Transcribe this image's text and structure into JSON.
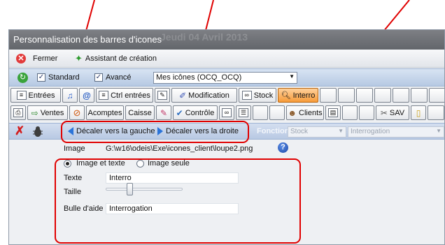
{
  "window": {
    "title": "Personnalisation des barres d'icones",
    "ghost_title": "Jeudi 04 Avril 2013"
  },
  "toolbar": {
    "close_label": "Fermer",
    "wizard_label": "Assistant de création"
  },
  "options": {
    "standard": {
      "label": "Standard",
      "checked": true
    },
    "avance": {
      "label": "Avancé",
      "checked": true
    },
    "icon_set": "Mes icônes (OCQ_OCQ)"
  },
  "icon_row_1": [
    {
      "label": "Entrées",
      "icon": "list-icon"
    },
    {
      "label": "",
      "icon": "music-icon"
    },
    {
      "label": "",
      "icon": "at-icon"
    },
    {
      "label": "Ctrl entrées",
      "icon": "list-icon"
    },
    {
      "label": "",
      "icon": "pen-icon"
    },
    {
      "label": "Modification",
      "icon": "edit-icon"
    },
    {
      "label": "Stock",
      "icon": "binoculars-icon"
    },
    {
      "label": "Interro",
      "icon": "magnifier-icon",
      "active": true
    }
  ],
  "icon_row_2": [
    {
      "label": "",
      "icon": "printer-icon"
    },
    {
      "label": "Ventes",
      "icon": "cart-icon"
    },
    {
      "label": "",
      "icon": "no-icon"
    },
    {
      "label": "Acomptes",
      "icon": ""
    },
    {
      "label": "Caisse",
      "icon": ""
    },
    {
      "label": "",
      "icon": "pen-icon"
    },
    {
      "label": "Contrôle",
      "icon": "check-icon"
    },
    {
      "label": "",
      "icon": "binoculars-icon"
    },
    {
      "label": "",
      "icon": "stack-icon"
    },
    {
      "label": "Clients",
      "icon": "person-icon"
    },
    {
      "label": "",
      "icon": "book-icon"
    },
    {
      "label": "SAV",
      "icon": "tools-icon"
    },
    {
      "label": "",
      "icon": "note-icon"
    }
  ],
  "edit": {
    "move_left": "Décaler vers la gauche",
    "move_right": "Décaler vers la droite",
    "function_label": "Fonction",
    "function_value": "Stock",
    "function_detail": "Interrogation"
  },
  "properties": {
    "image_label": "Image",
    "image_path": "G:\\w16\\odeis\\Exe\\icones_client\\loupe2.png",
    "help_glyph": "?",
    "mode_text_image": "Image et texte",
    "mode_image_only": "Image seule",
    "mode_selected": "text_image",
    "text_label": "Texte",
    "text_value": "Interro",
    "size_label": "Taille",
    "size_fraction": 0.3,
    "tooltip_label": "Bulle d'aide",
    "tooltip_value": "Interrogation"
  },
  "colors": {
    "annotation": "#e00000",
    "active_button": "#f79b39",
    "help": "#1c49a8"
  }
}
